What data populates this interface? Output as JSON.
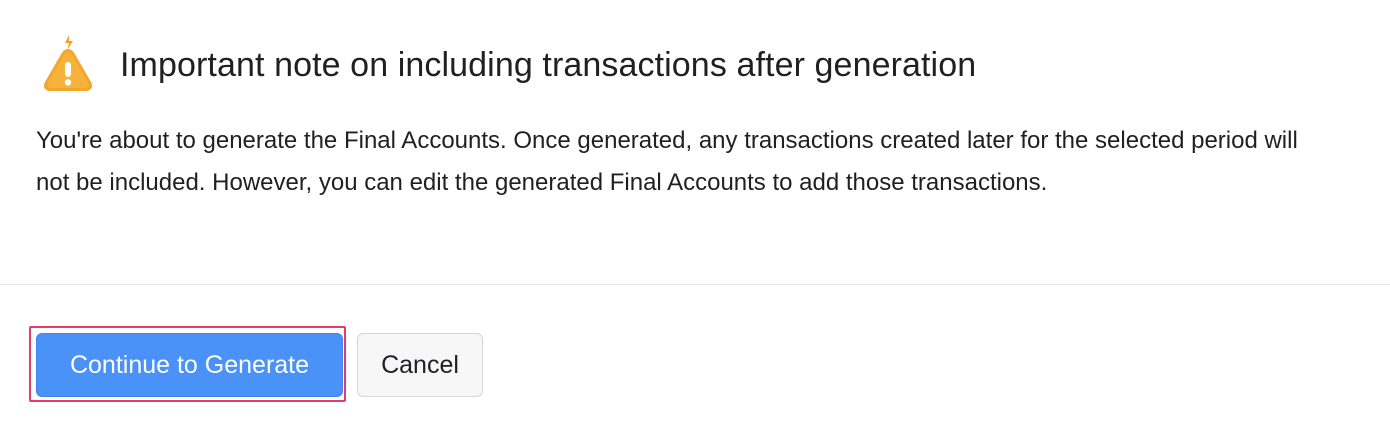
{
  "dialog": {
    "icon": "warning-triangle-icon",
    "icon_color": "#f0a22a",
    "title": "Important note on including transactions after generation",
    "message": "You're about to generate the Final Accounts. Once generated, any transactions created later for the selected period will not be included. However, you can edit the generated Final Accounts to add those transactions."
  },
  "actions": {
    "primary_label": "Continue to Generate",
    "secondary_label": "Cancel",
    "primary_color": "#4a92f8",
    "highlight_color": "#e63a6e"
  }
}
